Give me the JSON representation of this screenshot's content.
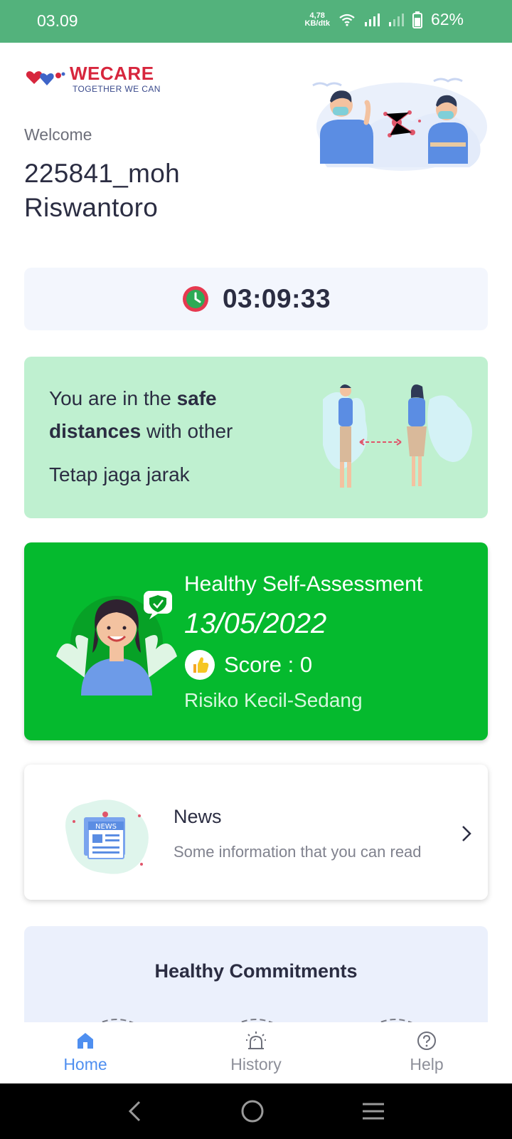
{
  "status_bar": {
    "time": "03.09",
    "net_speed_value": "4,78",
    "net_speed_unit": "KB/dtk",
    "battery": "62%"
  },
  "header": {
    "brand": "WECARE",
    "tagline": "TOGETHER WE CAN",
    "welcome": "Welcome",
    "username": "225841_moh Riswantoro"
  },
  "timer": {
    "value": "03:09:33"
  },
  "safe_distance": {
    "text_pre": "You are in the ",
    "text_bold1": "safe",
    "text_bold2": "distances",
    "text_post": " with other",
    "reminder": "Tetap jaga jarak"
  },
  "assessment": {
    "title": "Healthy Self-Assessment",
    "date": "13/05/2022",
    "score_label": "Score : 0",
    "risk": "Risiko Kecil-Sedang"
  },
  "news": {
    "badge": "NEWS",
    "title": "News",
    "subtitle": "Some information that you can read"
  },
  "commitments": {
    "title": "Healthy Commitments"
  },
  "bottom_nav": {
    "items": [
      {
        "label": "Home",
        "icon": "home-icon",
        "active": true
      },
      {
        "label": "History",
        "icon": "alarm-icon",
        "active": false
      },
      {
        "label": "Help",
        "icon": "help-icon",
        "active": false
      }
    ]
  },
  "colors": {
    "status_bar": "#53b27c",
    "safe_card": "#bff0d0",
    "assessment_card": "#05ba2e",
    "timer_card": "#f3f6fd",
    "commitments_card": "#ebf0fc",
    "active_nav": "#4f8ff0",
    "brand_red": "#d7263d"
  }
}
